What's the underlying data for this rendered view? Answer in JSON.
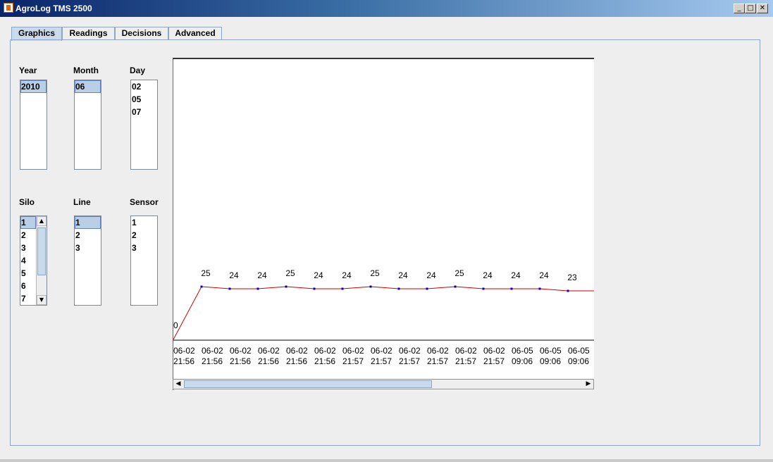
{
  "window": {
    "title": "AgroLog TMS 2500",
    "controls": {
      "minimize": "_",
      "maximize": "□",
      "close": "✕"
    }
  },
  "tabs": [
    {
      "label": "Graphics",
      "active": true
    },
    {
      "label": "Readings",
      "active": false
    },
    {
      "label": "Decisions",
      "active": false
    },
    {
      "label": "Advanced",
      "active": false
    }
  ],
  "filters": {
    "year": {
      "label": "Year",
      "items": [
        "2010"
      ],
      "selected": "2010"
    },
    "month": {
      "label": "Month",
      "items": [
        "06"
      ],
      "selected": "06"
    },
    "day": {
      "label": "Day",
      "items": [
        "02",
        "05",
        "07"
      ],
      "selected": null
    },
    "silo": {
      "label": "Silo",
      "items": [
        "1",
        "2",
        "3",
        "4",
        "5",
        "6",
        "7"
      ],
      "selected": "1"
    },
    "line": {
      "label": "Line",
      "items": [
        "1",
        "2",
        "3"
      ],
      "selected": "1"
    },
    "sensor": {
      "label": "Sensor",
      "items": [
        "1",
        "2",
        "3"
      ],
      "selected": null
    }
  },
  "chart_data": {
    "type": "line",
    "title": "",
    "xlabel": "",
    "ylabel": "",
    "ylim": [
      0,
      60
    ],
    "x": [
      "06-02 21:56",
      "06-02 21:56",
      "06-02 21:56",
      "06-02 21:56",
      "06-02 21:56",
      "06-02 21:56",
      "06-02 21:57",
      "06-02 21:57",
      "06-02 21:57",
      "06-02 21:57",
      "06-02 21:57",
      "06-02 21:57",
      "06-05 09:06",
      "06-05 09:06",
      "06-05 09:06"
    ],
    "x_date": [
      "06-02",
      "06-02",
      "06-02",
      "06-02",
      "06-02",
      "06-02",
      "06-02",
      "06-02",
      "06-02",
      "06-02",
      "06-02",
      "06-02",
      "06-05",
      "06-05",
      "06-05"
    ],
    "x_time": [
      "21:56",
      "21:56",
      "21:56",
      "21:56",
      "21:56",
      "21:56",
      "21:57",
      "21:57",
      "21:57",
      "21:57",
      "21:57",
      "21:57",
      "09:06",
      "09:06",
      "09:06"
    ],
    "series": [
      {
        "values": [
          0,
          25,
          24,
          24,
          25,
          24,
          24,
          25,
          24,
          24,
          25,
          24,
          24,
          24,
          23
        ],
        "color": "#cc0000",
        "marker_color": "#0000cc"
      }
    ],
    "grid": false,
    "legend": "none"
  }
}
